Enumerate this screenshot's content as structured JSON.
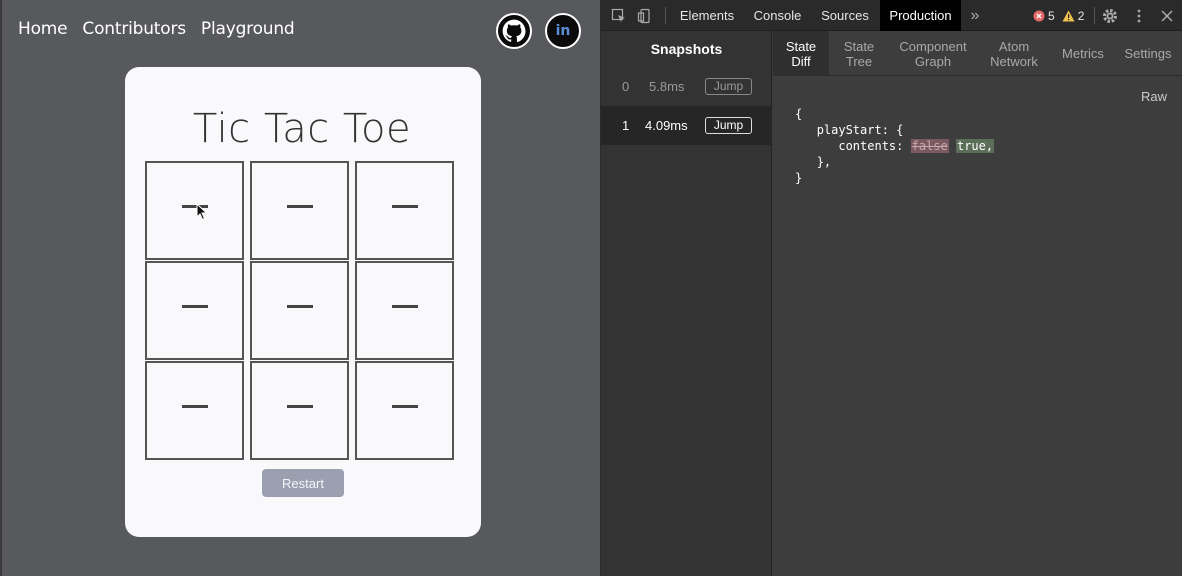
{
  "app": {
    "nav": [
      "Home",
      "Contributors",
      "Playground"
    ],
    "social": {
      "linkedin_label": "in"
    },
    "title": "Tic Tac Toe",
    "board": [
      "—",
      "—",
      "—",
      "—",
      "—",
      "—",
      "—",
      "—",
      "—"
    ],
    "restart_label": "Restart"
  },
  "devtools": {
    "tabs": [
      "Elements",
      "Console",
      "Sources",
      "Production"
    ],
    "more_icon": "»",
    "errors": "5",
    "warnings": "2",
    "snapshots": {
      "header": "Snapshots",
      "rows": [
        {
          "index": "0",
          "time": "5.8ms",
          "jump": "Jump"
        },
        {
          "index": "1",
          "time": "4.09ms",
          "jump": "Jump"
        }
      ]
    },
    "subtabs": [
      {
        "line1": "State",
        "line2": "Diff"
      },
      {
        "line1": "State",
        "line2": "Tree"
      },
      {
        "line1": "Component",
        "line2": "Graph"
      },
      {
        "line1": "Atom",
        "line2": "Network"
      },
      {
        "line1": "Metrics",
        "line2": ""
      },
      {
        "line1": "Settings",
        "line2": ""
      }
    ],
    "raw_label": "Raw",
    "diff": {
      "open": "{",
      "key": "playStart: {",
      "field": "contents:",
      "old_value": "false",
      "new_value": "true,",
      "close_inner": "},",
      "close": "}"
    }
  },
  "colors": {
    "app_bg": "#58595d",
    "card_bg": "#f9f9fb",
    "restart_bg": "#9aa0b0",
    "devtools_bg": "#3b3b3b",
    "active_tab": "#000000",
    "diff_removed": "#7a5a60",
    "diff_added": "#5b6e57"
  }
}
